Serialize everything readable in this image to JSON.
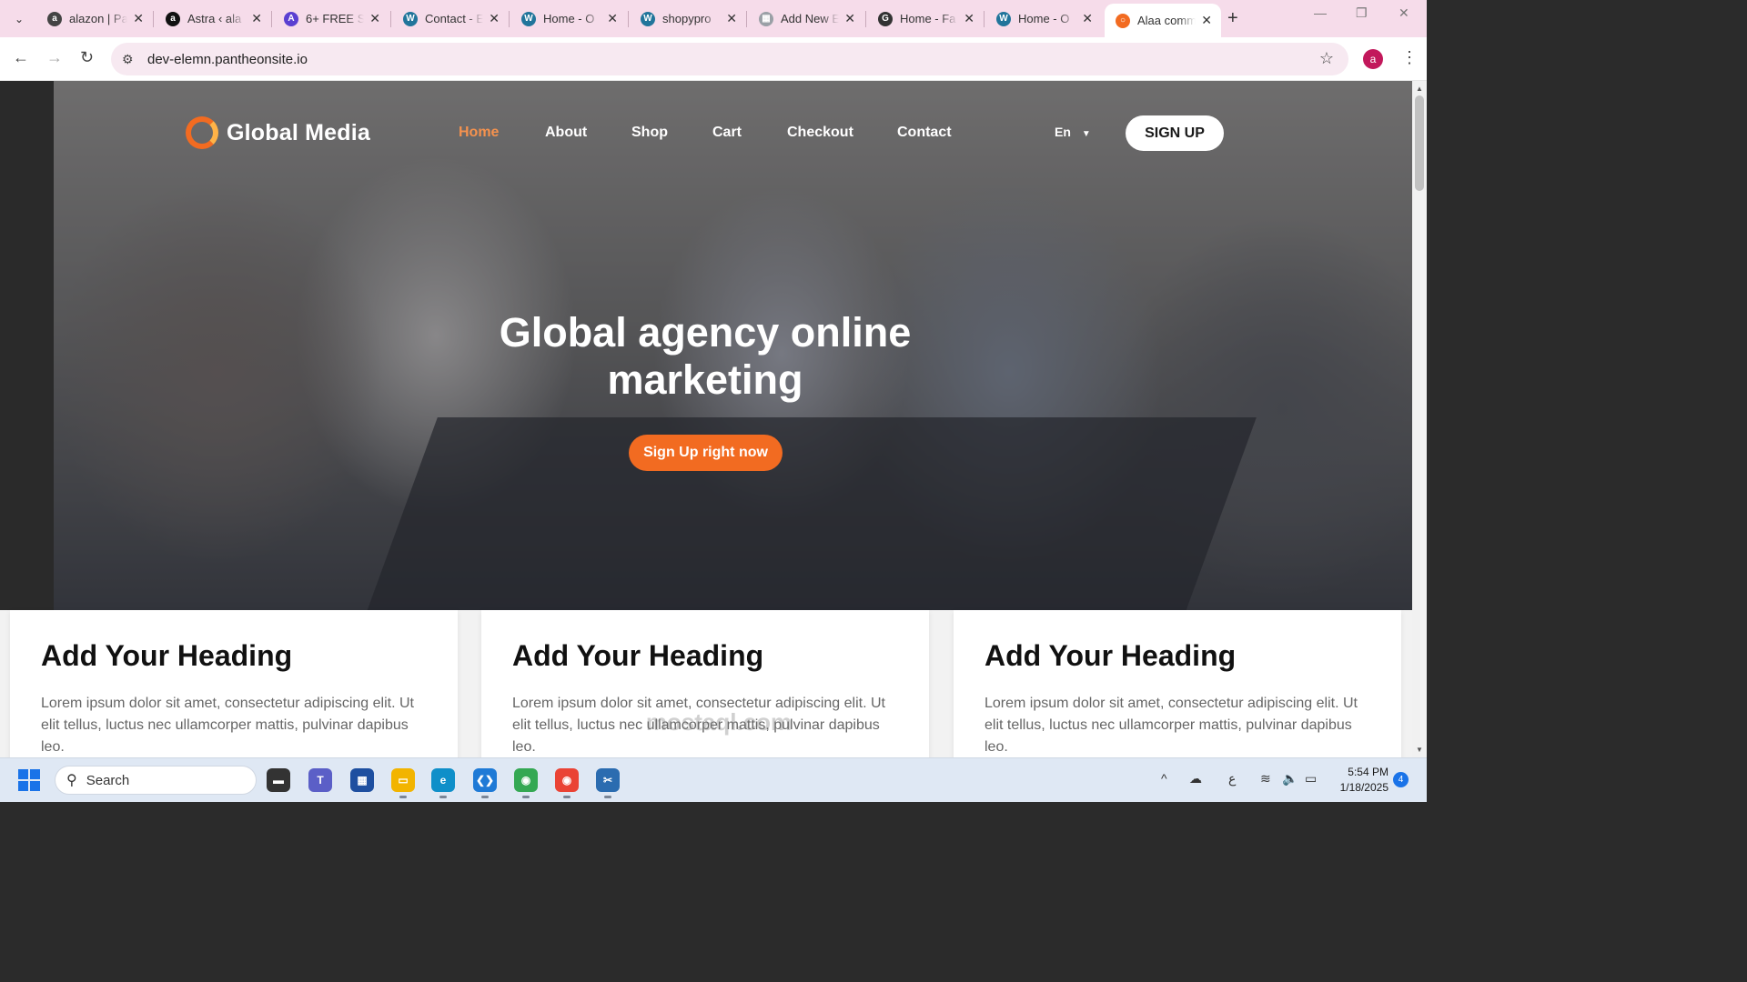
{
  "browser": {
    "tabs": [
      {
        "title": "alazon | Pa",
        "icon": "alazon-favicon",
        "color": "#444444",
        "glyph": "a"
      },
      {
        "title": "Astra ‹ ala",
        "icon": "amazon-icon",
        "color": "#111111",
        "glyph": "a"
      },
      {
        "title": "6+ FREE S",
        "icon": "astra-icon",
        "color": "#5a3fd1",
        "glyph": "A"
      },
      {
        "title": "Contact - E",
        "icon": "wordpress-icon",
        "color": "#21759b",
        "glyph": "W"
      },
      {
        "title": "Home - O",
        "icon": "wordpress-icon",
        "color": "#21759b",
        "glyph": "W"
      },
      {
        "title": "shopypro",
        "icon": "wordpress-icon",
        "color": "#21759b",
        "glyph": "W"
      },
      {
        "title": "Add New E",
        "icon": "page-icon",
        "color": "#9aa0a6",
        "glyph": "▦"
      },
      {
        "title": "Home - Fa",
        "icon": "gx-icon",
        "color": "#333333",
        "glyph": "G"
      },
      {
        "title": "Home - O",
        "icon": "wordpress-icon",
        "color": "#21759b",
        "glyph": "W"
      },
      {
        "title": "Alaa comm",
        "icon": "global-media-favicon",
        "color": "#f26b21",
        "glyph": "○"
      }
    ],
    "active_tab": 9,
    "url": "dev-elemn.pantheonsite.io",
    "profile_initial": "a"
  },
  "page": {
    "logo_text": "Global Media",
    "nav": [
      "Home",
      "About",
      "Shop",
      "Cart",
      "Checkout",
      "Contact"
    ],
    "active_nav": "Home",
    "language": "En",
    "signup_label": "SIGN UP",
    "hero_title_line1": "Global agency online",
    "hero_title_line2": "marketing",
    "hero_cta": "Sign Up right now",
    "cards": [
      {
        "heading": "Add Your Heading",
        "text": "Lorem ipsum dolor sit amet, consectetur adipiscing elit. Ut elit tellus, luctus nec ullamcorper mattis, pulvinar dapibus leo."
      },
      {
        "heading": "Add Your Heading",
        "text": "Lorem ipsum dolor sit amet, consectetur adipiscing elit. Ut elit tellus, luctus nec ullamcorper mattis, pulvinar dapibus leo."
      },
      {
        "heading": "Add Your Heading",
        "text": "Lorem ipsum dolor sit amet, consectetur adipiscing elit. Ut elit tellus, luctus nec ullamcorper mattis, pulvinar dapibus leo."
      }
    ],
    "watermark": "mostaql.com",
    "accent_color": "#f26b21"
  },
  "taskbar": {
    "search_label": "Search",
    "apps": [
      {
        "name": "task-view-icon",
        "color": "#333333",
        "glyph": "▬"
      },
      {
        "name": "teams-icon",
        "color": "#5b5fc7",
        "glyph": "T"
      },
      {
        "name": "store-icon",
        "color": "#1e4fa0",
        "glyph": "▦"
      },
      {
        "name": "file-explorer-icon",
        "color": "#f2b400",
        "glyph": "▭"
      },
      {
        "name": "edge-icon",
        "color": "#0f8fc9",
        "glyph": "e"
      },
      {
        "name": "vscode-icon",
        "color": "#1f7ad6",
        "glyph": "❮❯"
      },
      {
        "name": "chrome-icon",
        "color": "#34a853",
        "glyph": "◉"
      },
      {
        "name": "chrome-profile-icon",
        "color": "#ea4335",
        "glyph": "◉"
      },
      {
        "name": "snipping-tool-icon",
        "color": "#2b6cb0",
        "glyph": "✂"
      }
    ],
    "language_indicator": "ع",
    "time": "5:54 PM",
    "date": "1/18/2025",
    "notifications": "4"
  }
}
